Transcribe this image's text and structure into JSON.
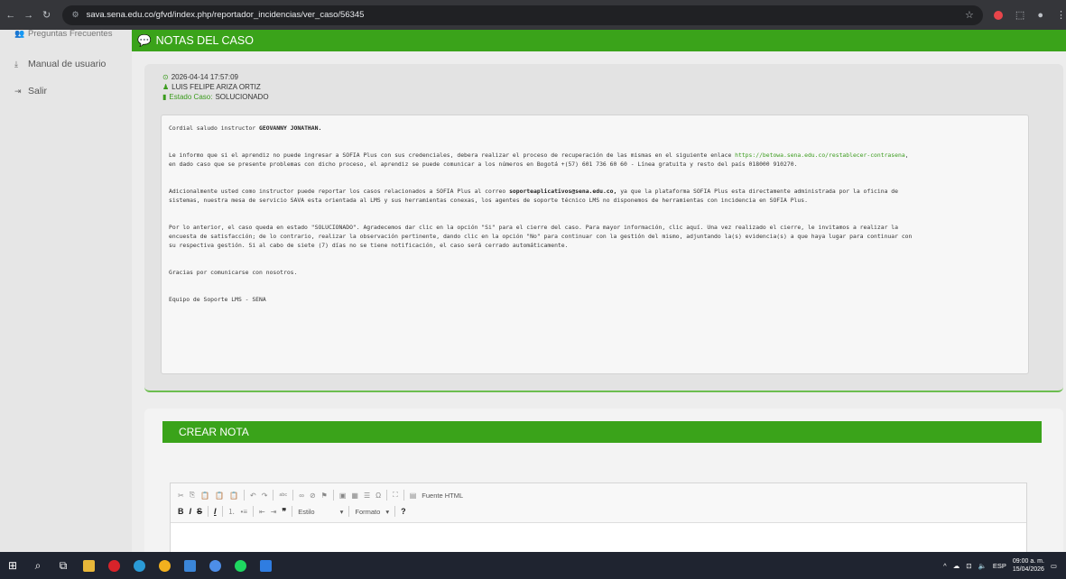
{
  "browser": {
    "url": "sava.sena.edu.co/gfvd/index.php/reportador_incidencias/ver_caso/56345"
  },
  "sidebar": {
    "items": [
      {
        "label": "Preguntas Frecuentes",
        "icon": "users-icon"
      },
      {
        "label": "Manual de usuario",
        "icon": "download-icon"
      },
      {
        "label": "Salir",
        "icon": "logout-icon"
      }
    ]
  },
  "notes": {
    "header": "NOTAS DEL CASO",
    "datetime": "2026-04-14 17:57:09",
    "author": "LUIS FELIPE ARIZA ORTIZ",
    "status_label": "Estado Caso:",
    "status_value": "SOLUCIONADO",
    "greeting_pre": "Cordial saludo instructor ",
    "greeting_name": "GEOVANNY JONATHAN.",
    "p1_a": "Le informo que si el aprendiz no puede ingresar a SOFIA Plus con sus credenciales, debera realizar el proceso de recuperación de las mismas en el siguiente enlace ",
    "p1_link": "https://betowa.sena.edu.co/restablecer-contrasena",
    "p1_b": ",",
    "p1_c": "en dado caso que se presente problemas con dicho proceso, el aprendiz se puede comunicar a los números en Bogotá +(57) 601 736 60 60 - Línea gratuita y resto del país 018000 910270.",
    "p2_a": "Adicionalmente usted como instructor puede reportar los casos relacionados a SOFIA Plus al correo ",
    "p2_email": "soporteaplicativos@sena.edu.co,",
    "p2_b": " ya que la plataforma SOFIA Plus esta directamente administrada por la oficina de",
    "p2_c": "sistemas, nuestra mesa de servicio SAVA esta orientada al LMS y sus herramientas conexas, los agentes de soporte técnico LMS no disponemos de herramientas con incidencia en SOFIA Plus.",
    "p3_a": "Por lo anterior, el caso queda en estado \"SOLUCIONADO\". Agradecemos dar clic en la opción \"Si\" para el cierre del caso. Para mayor información, clic aquí. Una vez realizado el cierre, le invitamos a realizar la",
    "p3_b": "encuesta de satisfacción; de lo contrario, realizar la observación pertinente, dando clic en la opción \"No\" para continuar con la gestión del mismo, adjuntando la(s) evidencia(s) a que haya lugar para continuar con",
    "p3_c": "su respectiva gestión. Si al cabo de siete (7) días no se tiene notificación, el caso será cerrado automáticamente.",
    "p4": "Gracias por comunicarse con nosotros.",
    "p5": "Equipo de Soporte LMS - SENA"
  },
  "crear_nota": {
    "header": "CREAR NOTA",
    "source_label": "Fuente HTML",
    "style_label": "Estilo",
    "format_label": "Formato"
  },
  "taskbar": {
    "lang": "ESP",
    "time": "09:00 a. m.",
    "date": "15/04/2026"
  }
}
